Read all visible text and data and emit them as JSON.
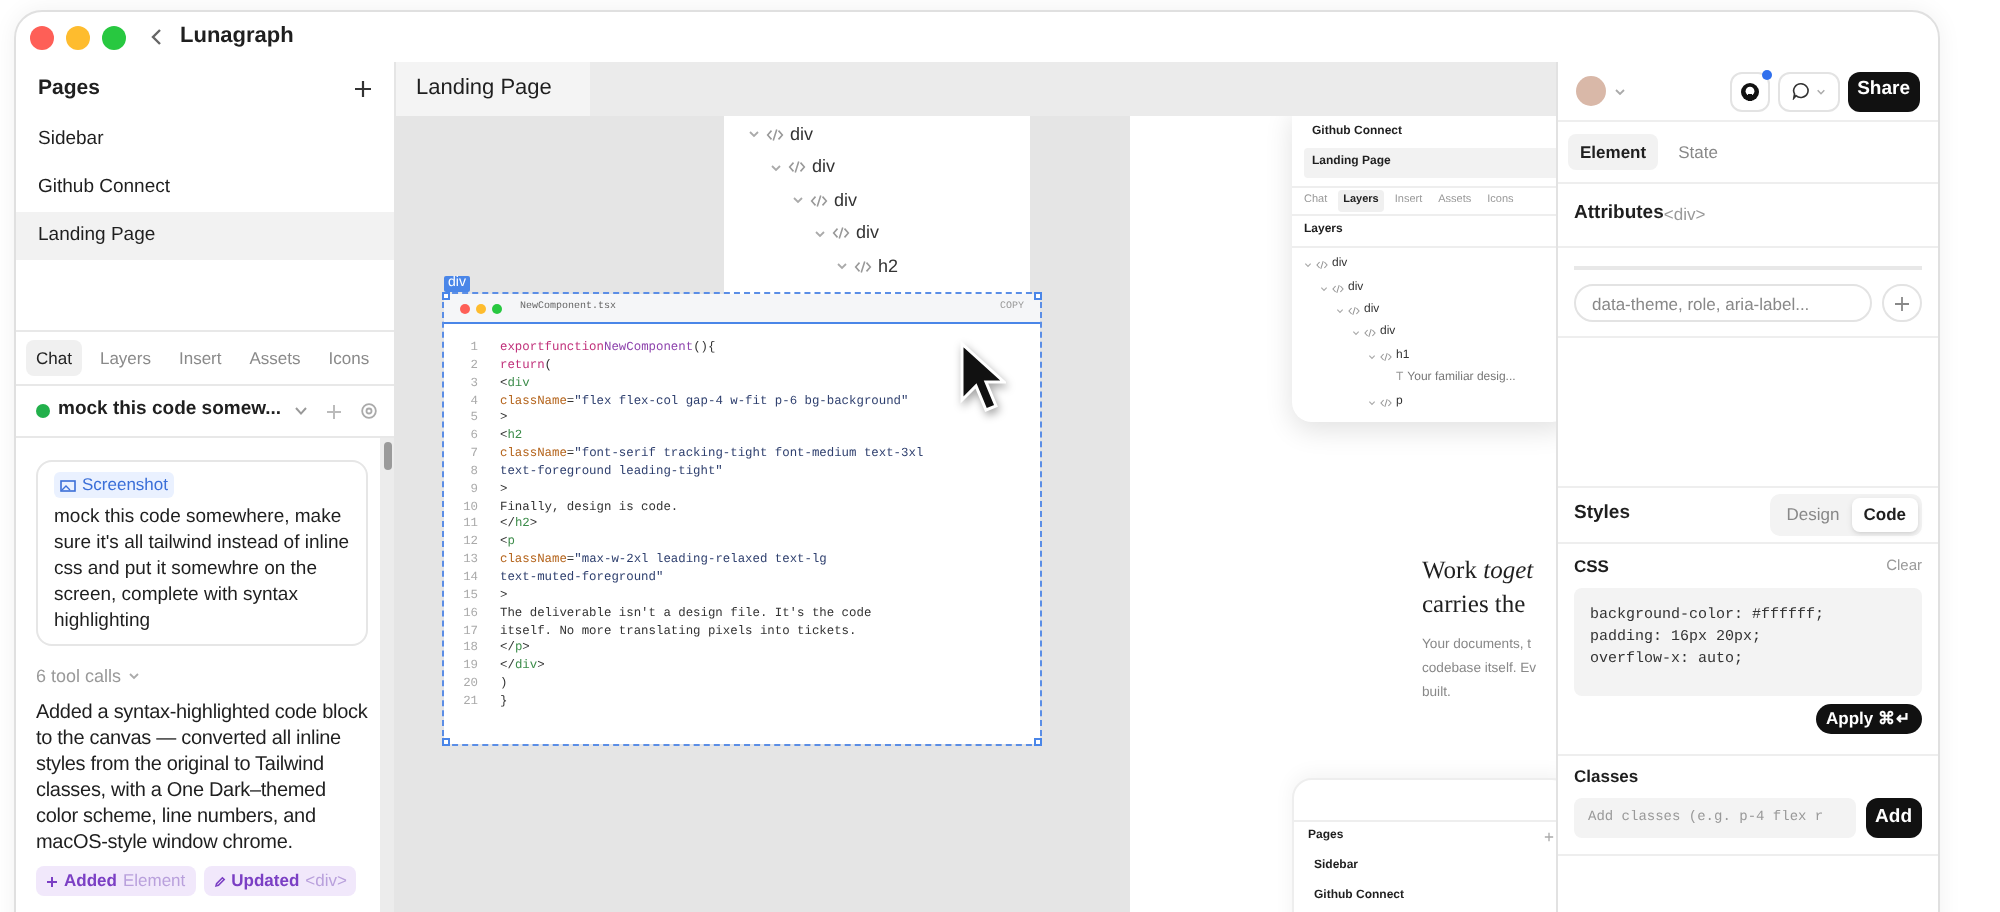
{
  "window": {
    "title": "Lunagraph"
  },
  "pages": {
    "title": "Pages",
    "items": [
      {
        "label": "Sidebar",
        "selected": false
      },
      {
        "label": "Github Connect",
        "selected": false
      },
      {
        "label": "Landing Page",
        "selected": true
      }
    ]
  },
  "left_tabs": [
    {
      "label": "Chat",
      "selected": true
    },
    {
      "label": "Layers",
      "selected": false
    },
    {
      "label": "Insert",
      "selected": false
    },
    {
      "label": "Assets",
      "selected": false
    },
    {
      "label": "Icons",
      "selected": false
    }
  ],
  "chat": {
    "title": "mock this code somew...",
    "message": {
      "attachment": "Screenshot",
      "text": "mock this code somewhere, make sure it's all tailwind instead of inline css and put it somewhre on the screen, complete with syntax highlighting"
    },
    "tool_calls": "6 tool calls",
    "reply": "Added a syntax-highlighted code block to the canvas — converted all inline styles from the original to Tailwind classes, with a One Dark–themed color scheme, line numbers, and macOS-style window chrome.",
    "changes": [
      {
        "kind": "added",
        "action": "Added",
        "target": "Element"
      },
      {
        "kind": "updated",
        "action": "Updated",
        "target": "<div>"
      }
    ]
  },
  "canvas": {
    "tab": "Landing Page",
    "layer_tree": [
      {
        "label": "div",
        "children": [
          {
            "label": "div",
            "children": [
              {
                "label": "div",
                "children": [
                  {
                    "label": "div",
                    "children": [
                      {
                        "label": "h2"
                      }
                    ]
                  }
                ]
              }
            ]
          }
        ]
      }
    ],
    "code_block": {
      "selection_label": "div",
      "filename": "NewComponent.tsx",
      "copy": "COPY",
      "lines": [
        {
          "n": "1",
          "tokens": [
            {
              "kind": "keyword",
              "text": "export"
            },
            {
              "kind": "keyword",
              "text": "function"
            },
            {
              "kind": "name",
              "text": "NewComponent"
            },
            {
              "kind": "text",
              "text": "(){"
            }
          ]
        },
        {
          "n": "2",
          "tokens": [
            {
              "kind": "keyword",
              "text": "return"
            },
            {
              "kind": "text",
              "text": "("
            }
          ]
        },
        {
          "n": "3",
          "tokens": [
            {
              "kind": "text",
              "text": "<"
            },
            {
              "kind": "tag",
              "text": "div"
            }
          ]
        },
        {
          "n": "4",
          "tokens": [
            {
              "kind": "attr",
              "text": "className"
            },
            {
              "kind": "text",
              "text": "="
            },
            {
              "kind": "string",
              "text": "\"flex flex-col gap-4 w-fit p-6 bg-background\""
            }
          ]
        },
        {
          "n": "5",
          "tokens": [
            {
              "kind": "text",
              "text": ">"
            }
          ]
        },
        {
          "n": "6",
          "tokens": [
            {
              "kind": "text",
              "text": "<"
            },
            {
              "kind": "tag",
              "text": "h2"
            }
          ]
        },
        {
          "n": "7",
          "tokens": [
            {
              "kind": "attr",
              "text": "className"
            },
            {
              "kind": "text",
              "text": "="
            },
            {
              "kind": "string",
              "text": "\"font-serif tracking-tight font-medium text-3xl"
            }
          ]
        },
        {
          "n": "8",
          "tokens": [
            {
              "kind": "string",
              "text": "text-foreground leading-tight\""
            }
          ]
        },
        {
          "n": "9",
          "tokens": [
            {
              "kind": "text",
              "text": ">"
            }
          ]
        },
        {
          "n": "10",
          "tokens": [
            {
              "kind": "text",
              "text": "Finally, design is code."
            }
          ]
        },
        {
          "n": "11",
          "tokens": [
            {
              "kind": "text",
              "text": "</"
            },
            {
              "kind": "tag",
              "text": "h2"
            },
            {
              "kind": "text",
              "text": ">"
            }
          ]
        },
        {
          "n": "12",
          "tokens": [
            {
              "kind": "text",
              "text": "<"
            },
            {
              "kind": "tag",
              "text": "p"
            }
          ]
        },
        {
          "n": "13",
          "tokens": [
            {
              "kind": "attr",
              "text": "className"
            },
            {
              "kind": "text",
              "text": "="
            },
            {
              "kind": "string",
              "text": "\"max-w-2xl leading-relaxed text-lg"
            }
          ]
        },
        {
          "n": "14",
          "tokens": [
            {
              "kind": "string",
              "text": "text-muted-foreground\""
            }
          ]
        },
        {
          "n": "15",
          "tokens": [
            {
              "kind": "text",
              "text": ">"
            }
          ]
        },
        {
          "n": "16",
          "tokens": [
            {
              "kind": "text",
              "text": "The deliverable isn't a design file. It's the code"
            }
          ]
        },
        {
          "n": "17",
          "tokens": [
            {
              "kind": "text",
              "text": "itself. No more translating pixels into tickets."
            }
          ]
        },
        {
          "n": "18",
          "tokens": [
            {
              "kind": "text",
              "text": "</"
            },
            {
              "kind": "tag",
              "text": "p"
            },
            {
              "kind": "text",
              "text": ">"
            }
          ]
        },
        {
          "n": "19",
          "tokens": [
            {
              "kind": "text",
              "text": "</"
            },
            {
              "kind": "tag",
              "text": "div"
            },
            {
              "kind": "text",
              "text": ">"
            }
          ]
        },
        {
          "n": "20",
          "tokens": [
            {
              "kind": "text",
              "text": ")"
            }
          ]
        },
        {
          "n": "21",
          "tokens": [
            {
              "kind": "text",
              "text": "}"
            }
          ]
        }
      ]
    },
    "preview": {
      "pages": [
        {
          "label": "Github Connect",
          "selected": false
        },
        {
          "label": "Landing Page",
          "selected": true
        }
      ],
      "tabs": [
        {
          "label": "Chat",
          "selected": false
        },
        {
          "label": "Layers",
          "selected": true
        },
        {
          "label": "Insert",
          "selected": false
        },
        {
          "label": "Assets",
          "selected": false
        },
        {
          "label": "Icons",
          "selected": false
        }
      ],
      "layers_title": "Layers",
      "layers": [
        {
          "kind": "element",
          "label": "div",
          "children": [
            {
              "kind": "element",
              "label": "div",
              "children": [
                {
                  "kind": "element",
                  "label": "div",
                  "children": [
                    {
                      "kind": "element",
                      "label": "div",
                      "children": [
                        {
                          "kind": "element",
                          "label": "h1",
                          "children": [
                            {
                              "kind": "text",
                              "icon": "T",
                              "label": "Your familiar desig..."
                            }
                          ]
                        },
                        {
                          "kind": "element",
                          "label": "p"
                        }
                      ]
                    }
                  ]
                }
              ]
            }
          ]
        }
      ],
      "heading": [
        "Work *toget*",
        "carries the"
      ],
      "paragraph": [
        "Your documents, t",
        "codebase itself. Ev",
        "built."
      ],
      "bottom_card": {
        "title": "Pages",
        "items": [
          "Sidebar",
          "Github Connect"
        ]
      }
    }
  },
  "inspector": {
    "share": "Share",
    "tabs": [
      {
        "label": "Element",
        "selected": true
      },
      {
        "label": "State",
        "selected": false
      }
    ],
    "attributes": {
      "title": "Attributes",
      "tag": "<div>",
      "placeholder": "data-theme, role, aria-label..."
    },
    "styles": {
      "title": "Styles",
      "modes": [
        {
          "label": "Design",
          "selected": false
        },
        {
          "label": "Code",
          "selected": true
        }
      ],
      "css_label": "CSS",
      "clear": "Clear",
      "css": [
        "background-color: #ffffff;",
        "padding: 16px 20px;",
        "overflow-x: auto;"
      ],
      "apply": "Apply ⌘↵"
    },
    "classes": {
      "title": "Classes",
      "placeholder": "Add classes (e.g. p-4 flex r",
      "add": "Add"
    }
  }
}
